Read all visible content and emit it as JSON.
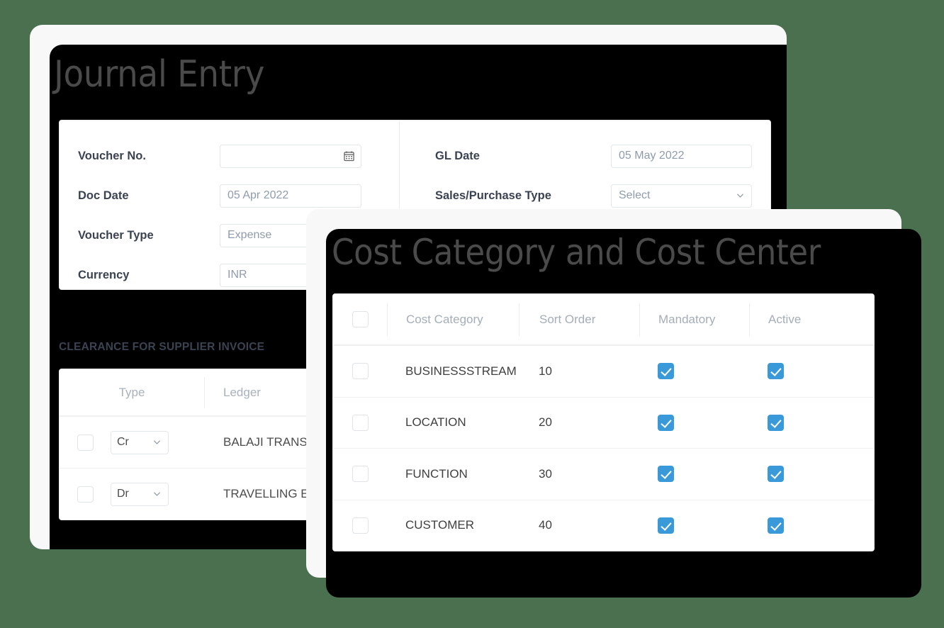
{
  "theme": {
    "background": "#4a7050",
    "panel_bg": "#f8f8f8",
    "accent": "#3a9ad9",
    "shadow": "#000000"
  },
  "journal_entry": {
    "title": "Journal Entry",
    "form": {
      "left_fields": [
        {
          "label": "Voucher No.",
          "value": "",
          "control": "date-input",
          "icon": "calendar-icon"
        },
        {
          "label": "Doc Date",
          "value": "05 Apr 2022",
          "control": "date-input",
          "icon": ""
        },
        {
          "label": "Voucher Type",
          "value": "Expense",
          "control": "text-input",
          "icon": ""
        },
        {
          "label": "Currency",
          "value": "INR",
          "control": "text-input",
          "icon": ""
        }
      ],
      "right_fields": [
        {
          "label": "GL Date",
          "value": "05 May 2022",
          "control": "date-input",
          "icon": ""
        },
        {
          "label": "Sales/Purchase Type",
          "value": "Select",
          "control": "select",
          "icon": "chevron-down-icon"
        }
      ]
    },
    "section_title": "CLEARANCE FOR SUPPLIER INVOICE",
    "table": {
      "columns": [
        "Type",
        "Ledger"
      ],
      "rows": [
        {
          "selected": false,
          "type": "Cr",
          "ledger": "BALAJI TRANSWORLD"
        },
        {
          "selected": false,
          "type": "Dr",
          "ledger": "TRAVELLING EXPENSES"
        }
      ]
    }
  },
  "cost_category": {
    "title": "Cost Category and Cost Center",
    "table": {
      "select_all": false,
      "columns": [
        "Cost Category",
        "Sort Order",
        "Mandatory",
        "Active"
      ],
      "rows": [
        {
          "selected": false,
          "category": "BUSINESSSTREAM",
          "sort_order": "10",
          "mandatory": true,
          "active": true
        },
        {
          "selected": false,
          "category": "LOCATION",
          "sort_order": "20",
          "mandatory": true,
          "active": true
        },
        {
          "selected": false,
          "category": "FUNCTION",
          "sort_order": "30",
          "mandatory": true,
          "active": true
        },
        {
          "selected": false,
          "category": "CUSTOMER",
          "sort_order": "40",
          "mandatory": true,
          "active": true
        }
      ]
    }
  }
}
